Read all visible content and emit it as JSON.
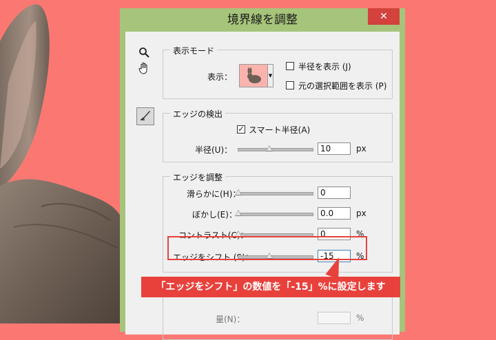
{
  "dialog": {
    "title": "境界線を調整",
    "close_glyph": "✕"
  },
  "tools": {
    "zoom_icon": "search-icon",
    "hand_icon": "hand-icon",
    "brush_icon": "brush-icon"
  },
  "view_mode": {
    "legend": "表示モード",
    "view_label": "表示：",
    "show_radius": "半径を表示 (J)",
    "show_original": "元の選択範囲を表示 (P)"
  },
  "edge_detection": {
    "legend": "エッジの検出",
    "smart_radius": "スマート半径(A)",
    "radius_label": "半径(U)：",
    "radius_value": "10",
    "radius_unit": "px",
    "radius_level": 0.42
  },
  "adjust_edge": {
    "legend": "エッジを調整",
    "smooth_label": "滑らかに(H)：",
    "smooth_value": "0",
    "smooth_level": 0.0,
    "feather_label": "ぼかし(E)：",
    "feather_value": "0.0",
    "feather_unit": "px",
    "feather_level": 0.0,
    "contrast_label": "コントラスト(C)：",
    "contrast_value": "0",
    "contrast_unit": "%",
    "contrast_level": 0.0,
    "shift_label": "エッジをシフト (S)：",
    "shift_value": "-15",
    "shift_unit": "%",
    "shift_level": 0.42
  },
  "output": {
    "amount_label": "量(N)：",
    "amount_unit": "%"
  },
  "callout": {
    "text": "「エッジをシフト」の数値を「-15」%に設定します"
  },
  "colors": {
    "background": "#fb7872",
    "dialog_frame": "#a6c47a",
    "close_button": "#d3423c",
    "highlight": "#e8413c"
  }
}
